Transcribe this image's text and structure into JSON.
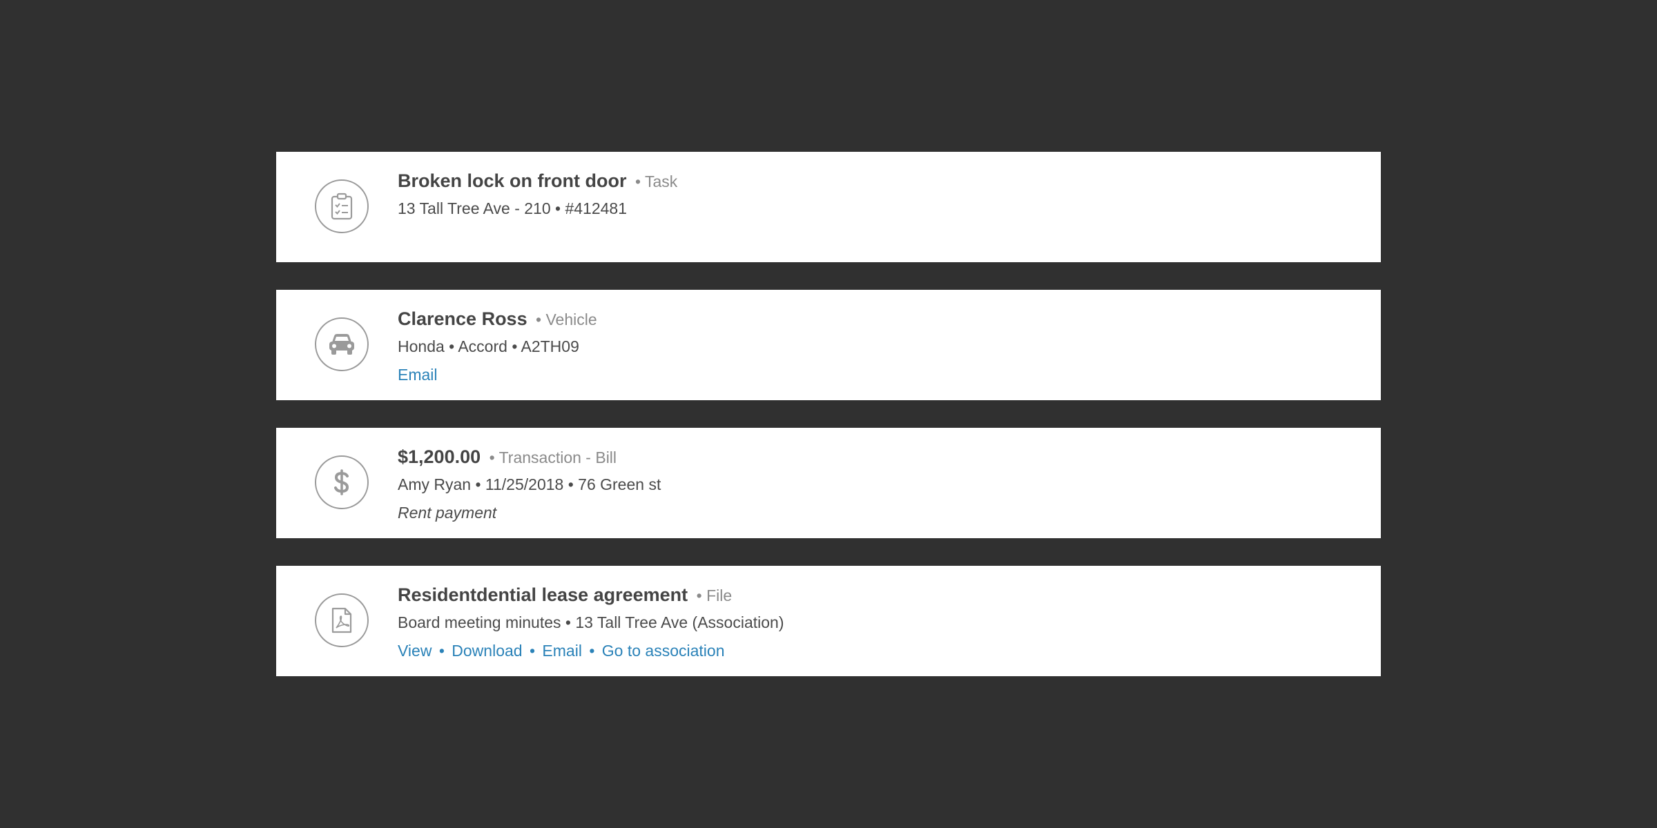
{
  "results": [
    {
      "icon": "clipboard-icon",
      "title": "Broken lock on front door",
      "type": "• Task",
      "detail": "13 Tall Tree Ave - 210 • #412481"
    },
    {
      "icon": "car-icon",
      "title": "Clarence Ross",
      "type": "• Vehicle",
      "detail": "Honda • Accord • A2TH09",
      "links": [
        "Email"
      ]
    },
    {
      "icon": "dollar-icon",
      "title": "$1,200.00",
      "type": "• Transaction - Bill",
      "detail": "Amy Ryan • 11/25/2018 • 76 Green st",
      "note": "Rent payment"
    },
    {
      "icon": "pdf-file-icon",
      "title": "Residentdential lease agreement",
      "type": "• File",
      "detail": "Board meeting minutes • 13 Tall Tree Ave (Association)",
      "links": [
        "View",
        "Download",
        "Email",
        "Go to association"
      ],
      "link_separator": "•"
    }
  ],
  "colors": {
    "background": "#303030",
    "card": "#ffffff",
    "link": "#2a82b8",
    "icon": "#9a9a9a"
  }
}
